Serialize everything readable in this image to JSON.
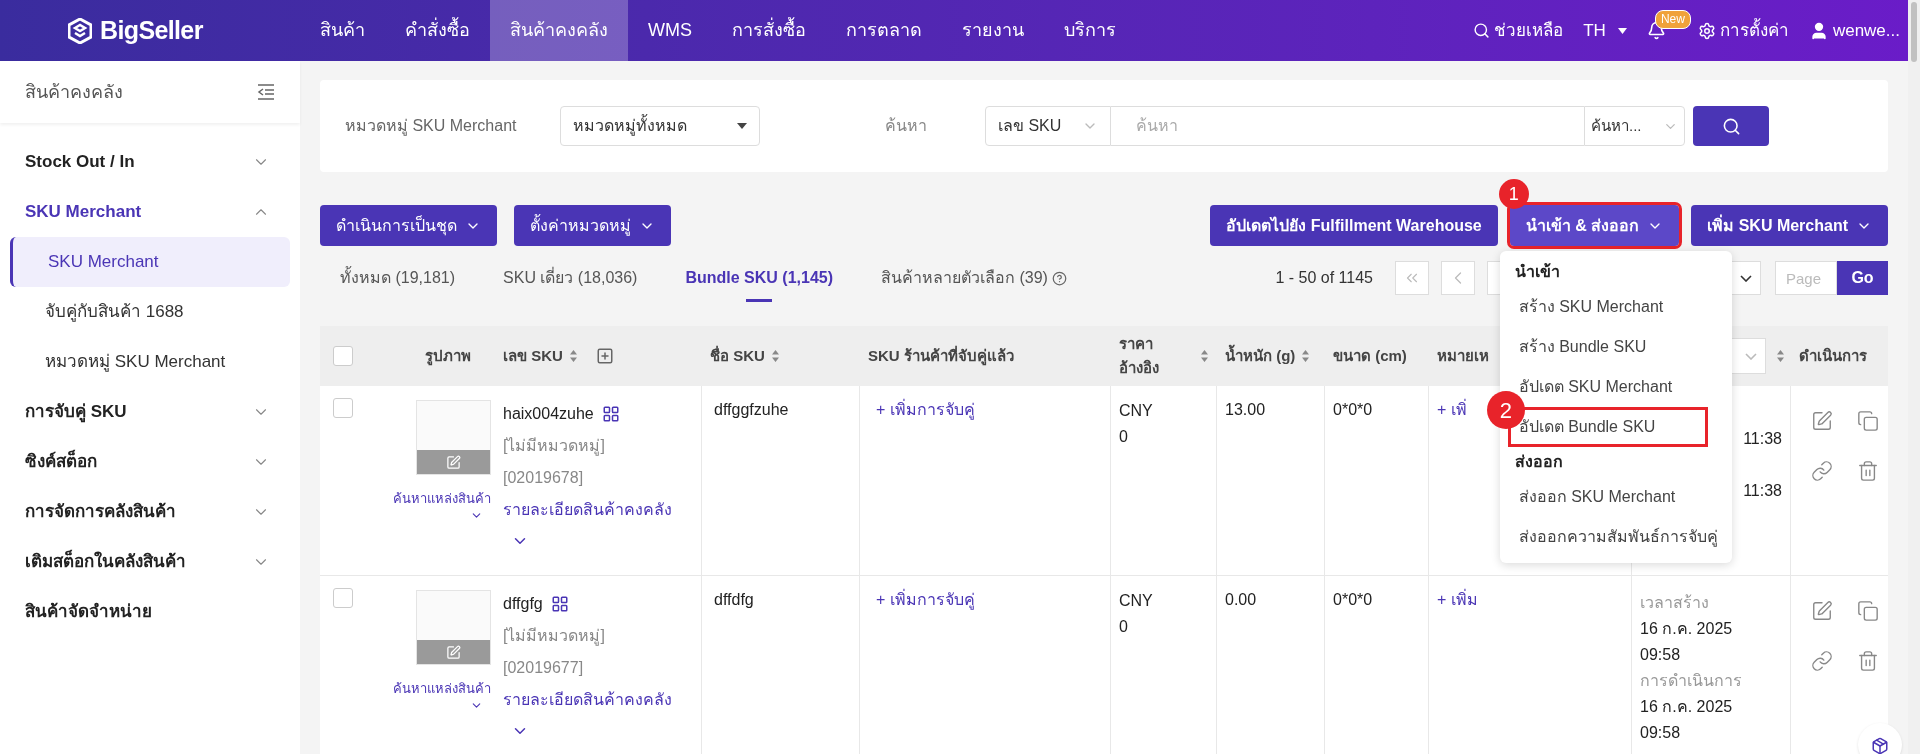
{
  "topbar": {
    "logo": "BigSeller",
    "nav": [
      {
        "label": "สินค้า",
        "selected": false
      },
      {
        "label": "คำสั่งซื้อ",
        "selected": false
      },
      {
        "label": "สินค้าคงคลัง",
        "selected": true
      },
      {
        "label": "WMS",
        "selected": false
      },
      {
        "label": "การสั่งซื้อ",
        "selected": false
      },
      {
        "label": "การตลาด",
        "selected": false
      },
      {
        "label": "รายงาน",
        "selected": false
      },
      {
        "label": "บริการ",
        "selected": false
      }
    ],
    "help": "ช่วยเหลือ",
    "language": "TH",
    "badge": "New",
    "settings": "การตั้งค่า",
    "user": "wenwe..."
  },
  "sidebar": {
    "title": "สินค้าคงคลัง",
    "items": [
      {
        "label": "Stock Out / In",
        "kind": "group",
        "expanded": false
      },
      {
        "label": "SKU Merchant",
        "kind": "group",
        "expanded": true,
        "children": [
          {
            "label": "SKU Merchant",
            "selected": true
          },
          {
            "label": "จับคู่กับสินค้า 1688",
            "selected": false
          },
          {
            "label": "หมวดหมู่ SKU Merchant",
            "selected": false
          }
        ]
      },
      {
        "label": "การจับคู่ SKU",
        "kind": "group",
        "expanded": false
      },
      {
        "label": "ซิงค์สต็อก",
        "kind": "group",
        "expanded": false
      },
      {
        "label": "การจัดการคลังสินค้า",
        "kind": "group",
        "expanded": false
      },
      {
        "label": "เติมสต็อกในคลังสินค้า",
        "kind": "group",
        "expanded": false
      },
      {
        "label": "สินค้าจัดจำหน่าย",
        "kind": "link"
      }
    ]
  },
  "filter": {
    "category_label": "หมวดหมู่ SKU Merchant",
    "category_value": "หมวดหมู่ทั้งหมด",
    "search_label": "ค้นหา",
    "search_field": "เลข SKU",
    "search_placeholder": "ค้นหา",
    "search_mode": "ค้นหา..."
  },
  "toolbar": {
    "left": [
      "ดำเนินการเป็นชุด",
      "ตั้งค่าหมวดหมู่"
    ],
    "right": [
      {
        "label": "อัปเดตไปยัง Fulfillment Warehouse",
        "open": false
      },
      {
        "label": "นำเข้า & ส่งออก",
        "open": true,
        "annotation": "1"
      },
      {
        "label": "เพิ่ม SKU Merchant",
        "open": false
      }
    ]
  },
  "tabs": [
    {
      "label": "ทั้งหมด (19,181)",
      "selected": false
    },
    {
      "label": "SKU เดี่ยว (18,036)",
      "selected": false
    },
    {
      "label": "Bundle SKU (1,145)",
      "selected": true
    },
    {
      "label": "สินค้าหลายตัวเลือก (39)",
      "selected": false,
      "help": true
    }
  ],
  "pagination": {
    "range": "1 - 50 of 1145",
    "page_placeholder": "Page",
    "go": "Go"
  },
  "dropdown": {
    "sections": [
      {
        "title": "นำเข้า",
        "items": [
          {
            "label": "สร้าง SKU Merchant",
            "highlighted": false
          },
          {
            "label": "สร้าง Bundle SKU",
            "highlighted": false
          },
          {
            "label": "อัปเดต SKU Merchant",
            "highlighted": false
          },
          {
            "label": "อัปเดต Bundle SKU",
            "highlighted": true,
            "annotation": "2"
          }
        ]
      },
      {
        "title": "ส่งออก",
        "items": [
          {
            "label": "ส่งออก SKU Merchant",
            "highlighted": false
          },
          {
            "label": "ส่งออกความสัมพันธ์การจับคู่",
            "highlighted": false
          }
        ]
      }
    ]
  },
  "table": {
    "select_all_checked": false,
    "columns": [
      {
        "label": "รูปภาพ"
      },
      {
        "label": "เลข SKU"
      },
      {
        "label": "ชื่อ SKU"
      },
      {
        "label": "SKU ร้านค้าที่จับคู่แล้ว"
      },
      {
        "label": "ราคา อ้างอิง"
      },
      {
        "label": "น้ำหนัก (g)"
      },
      {
        "label": "ขนาด (cm)"
      },
      {
        "label": "หมายเห"
      },
      {
        "label": "ดำเนินการ"
      }
    ],
    "rows": [
      {
        "checked": false,
        "image_link": "ค้นหาแหล่งสินค้า",
        "sku": "haix004zuhe",
        "category": "[ไม่มีหมวดหมู่]",
        "code": "[02019678]",
        "detail_link": "รายละเอียดสินค้าคงคลัง",
        "name": "dffggfzuhe",
        "match_link": "+ เพิ่มการจับคู่",
        "currency": "CNY",
        "price": "0",
        "weight": "13.00",
        "size": "0*0*0",
        "note_link": "+ เพิ่",
        "times": [
          {
            "text": "11:38",
            "kind": "time"
          },
          {
            "text": "11:38",
            "kind": "time"
          }
        ]
      },
      {
        "checked": false,
        "image_link": "ค้นหาแหล่งสินค้า",
        "sku": "dffgfg",
        "category": "[ไม่มีหมวดหมู่]",
        "code": "[02019677]",
        "detail_link": "รายละเอียดสินค้าคงคลัง",
        "name": "dffdfg",
        "match_link": "+ เพิ่มการจับคู่",
        "currency": "CNY",
        "price": "0",
        "weight": "0.00",
        "size": "0*0*0",
        "note_link": "+ เพิ่ม",
        "times": [
          {
            "text": "เวลาสร้าง",
            "kind": "label"
          },
          {
            "text": "16 ก.ค. 2025",
            "kind": "value"
          },
          {
            "text": "09:58",
            "kind": "value"
          },
          {
            "text": "การดำเนินการ",
            "kind": "label"
          },
          {
            "text": "16 ก.ค. 2025",
            "kind": "value"
          },
          {
            "text": "09:58",
            "kind": "value"
          }
        ]
      }
    ]
  }
}
